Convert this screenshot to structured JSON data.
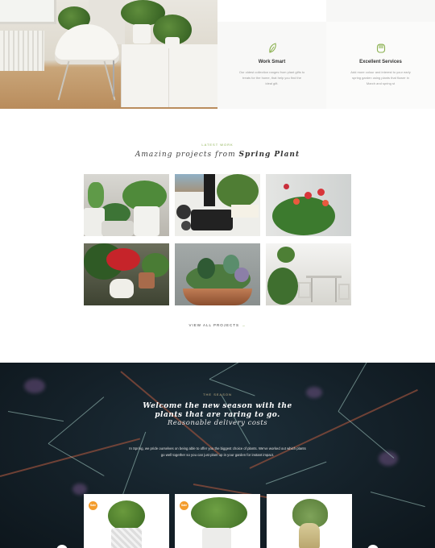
{
  "features": [
    {
      "title": "Work Smart",
      "text": "Our oldest collection ranges from plant gifts to treats for the home, that help you find the ideal gift.",
      "icon": "leaf-icon"
    },
    {
      "title": "Excellent Services",
      "text": "Add more colour and interest to your early spring garden using plants that flower in March and spring st",
      "icon": "hand-icon"
    }
  ],
  "projects": {
    "kicker": "LATEST WORK",
    "title_prefix": "Amazing projects from ",
    "title_brand": "Spring Plant",
    "view_all_label": "VIEW ALL PROJECTS",
    "arrow": "→"
  },
  "banner": {
    "kicker": "THE SEASON",
    "title_line1": "Welcome the new season with the",
    "title_line2": "plants that are raring to go.",
    "subtitle": "Reasonable delivery costs",
    "text": "In Spring, we pride ourselves on being able to offer you the biggest choice of plants. We've worked out which plants go well together so you can just plant up in your garden for instant impact."
  },
  "products": [
    {
      "badge": "Sale",
      "icon": "boxwood-plant-icon"
    },
    {
      "badge": "Sale",
      "icon": "potted-shrub-icon"
    },
    {
      "badge": "",
      "icon": "air-plant-icon"
    }
  ],
  "colors": {
    "accent_green": "#8ab04f",
    "badge_orange": "#f39c2c",
    "banner_dark": "#142028"
  }
}
